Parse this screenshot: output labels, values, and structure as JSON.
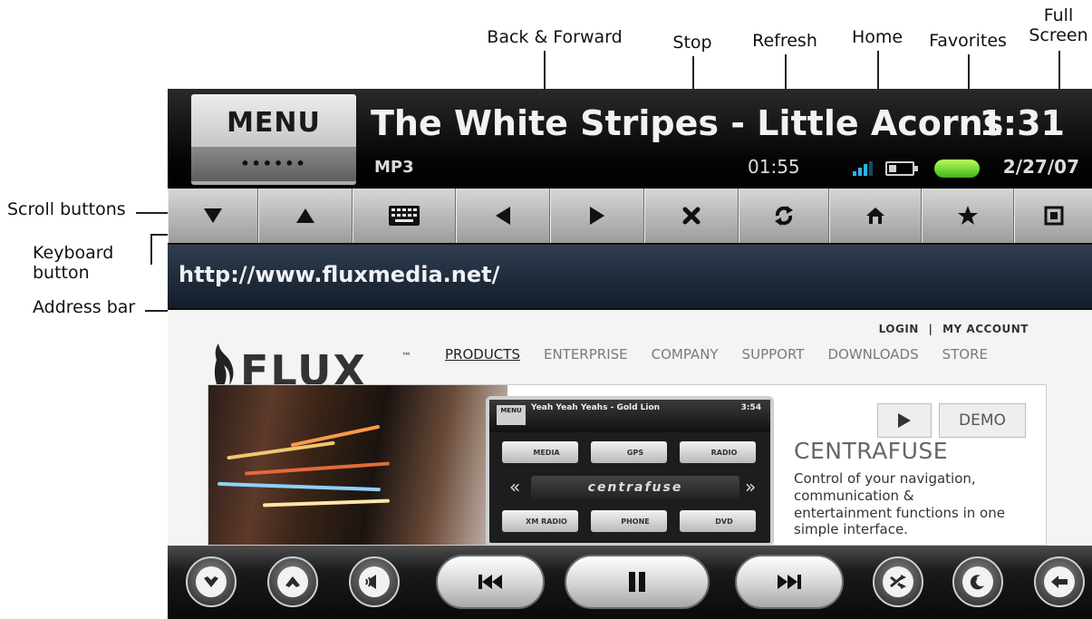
{
  "callouts": {
    "back_forward": "Back & Forward",
    "stop": "Stop",
    "refresh": "Refresh",
    "home": "Home",
    "favorites": "Favorites",
    "full_screen_line1": "Full",
    "full_screen_line2": "Screen",
    "scroll_buttons": "Scroll buttons",
    "keyboard_line1": "Keyboard",
    "keyboard_line2": "button",
    "address_bar": "Address bar"
  },
  "header": {
    "menu_label": "MENU",
    "menu_dots": "••••••",
    "song_title": "The White Stripes - Little Acorns",
    "clock": "1:31",
    "format": "MP3",
    "elapsed": "01:55",
    "date": "2/27/07",
    "signal_icon": "signal-strength-icon",
    "battery_icon": "battery-icon"
  },
  "toolbar": {
    "buttons": [
      {
        "name": "scroll-down-button",
        "icon": "triangle-down-icon"
      },
      {
        "name": "scroll-up-button",
        "icon": "triangle-up-icon"
      },
      {
        "name": "keyboard-button",
        "icon": "keyboard-icon"
      },
      {
        "name": "back-button",
        "icon": "arrow-left-icon"
      },
      {
        "name": "forward-button",
        "icon": "arrow-right-icon"
      },
      {
        "name": "stop-button",
        "icon": "x-icon"
      },
      {
        "name": "refresh-button",
        "icon": "refresh-icon"
      },
      {
        "name": "home-button",
        "icon": "home-icon"
      },
      {
        "name": "favorites-button",
        "icon": "star-icon"
      },
      {
        "name": "full-screen-button",
        "icon": "fullscreen-icon"
      }
    ]
  },
  "address": {
    "url": "http://www.fluxmedia.net/"
  },
  "site": {
    "logo_text": "FLUX",
    "trademark": "™",
    "login": "LOGIN",
    "separator": "|",
    "my_account": "MY ACCOUNT",
    "nav": [
      "PRODUCTS",
      "ENTERPRISE",
      "COMPANY",
      "SUPPORT",
      "DOWNLOADS",
      "STORE"
    ],
    "demo_label": "DEMO",
    "centrafuse_title": "CENTRAFUSE",
    "centrafuse_desc": "Control of your navigation, communication & entertainment functions in one simple interface.",
    "preview": {
      "menu": "MENU",
      "title": "Yeah Yeah Yeahs - Gold Lion",
      "time": "3:54",
      "buttons_row1": [
        "MEDIA",
        "GPS",
        "RADIO"
      ],
      "buttons_row2": [
        "XM RADIO",
        "PHONE",
        "DVD"
      ],
      "logo": "centrafuse"
    }
  },
  "controlbar": {
    "buttons": [
      {
        "name": "favorite-down-button",
        "icon": "heart-down-icon"
      },
      {
        "name": "favorite-up-button",
        "icon": "heart-up-icon"
      },
      {
        "name": "volume-button",
        "icon": "speaker-icon"
      },
      {
        "name": "previous-track-button",
        "icon": "skip-back-icon"
      },
      {
        "name": "pause-button",
        "icon": "pause-icon"
      },
      {
        "name": "next-track-button",
        "icon": "skip-forward-icon"
      },
      {
        "name": "shuffle-button",
        "icon": "shuffle-icon"
      },
      {
        "name": "night-mode-button",
        "icon": "moon-icon"
      },
      {
        "name": "back-exit-button",
        "icon": "back-arrow-icon"
      }
    ]
  }
}
